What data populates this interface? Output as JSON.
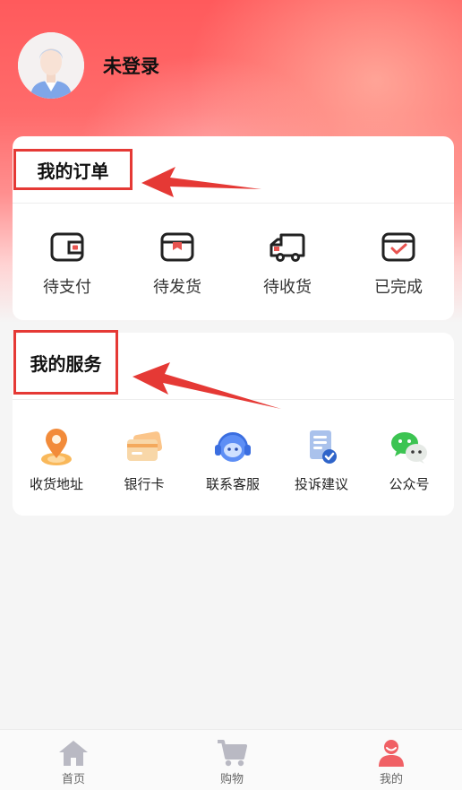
{
  "profile": {
    "login_status": "未登录",
    "avatar_icon": "user-avatar-icon"
  },
  "orders": {
    "title": "我的订单",
    "items": [
      {
        "label": "待支付",
        "icon": "wallet-icon"
      },
      {
        "label": "待发货",
        "icon": "package-box-icon"
      },
      {
        "label": "待收货",
        "icon": "delivery-truck-icon"
      },
      {
        "label": "已完成",
        "icon": "completed-check-icon"
      }
    ]
  },
  "services": {
    "title": "我的服务",
    "items": [
      {
        "label": "收货地址",
        "icon": "location-pin-icon"
      },
      {
        "label": "银行卡",
        "icon": "bank-card-icon"
      },
      {
        "label": "联系客服",
        "icon": "customer-service-icon"
      },
      {
        "label": "投诉建议",
        "icon": "complaint-document-icon"
      },
      {
        "label": "公众号",
        "icon": "wechat-icon"
      }
    ]
  },
  "tabbar": {
    "items": [
      {
        "label": "首页",
        "icon": "home-icon",
        "active": false
      },
      {
        "label": "购物",
        "icon": "shopping-cart-icon",
        "active": false
      },
      {
        "label": "我的",
        "icon": "profile-icon",
        "active": true
      }
    ]
  },
  "colors": {
    "accent": "#e53935",
    "header_red": "#ff5a5c",
    "inactive_icon": "#b9b9c3",
    "active_icon": "#f06065"
  }
}
